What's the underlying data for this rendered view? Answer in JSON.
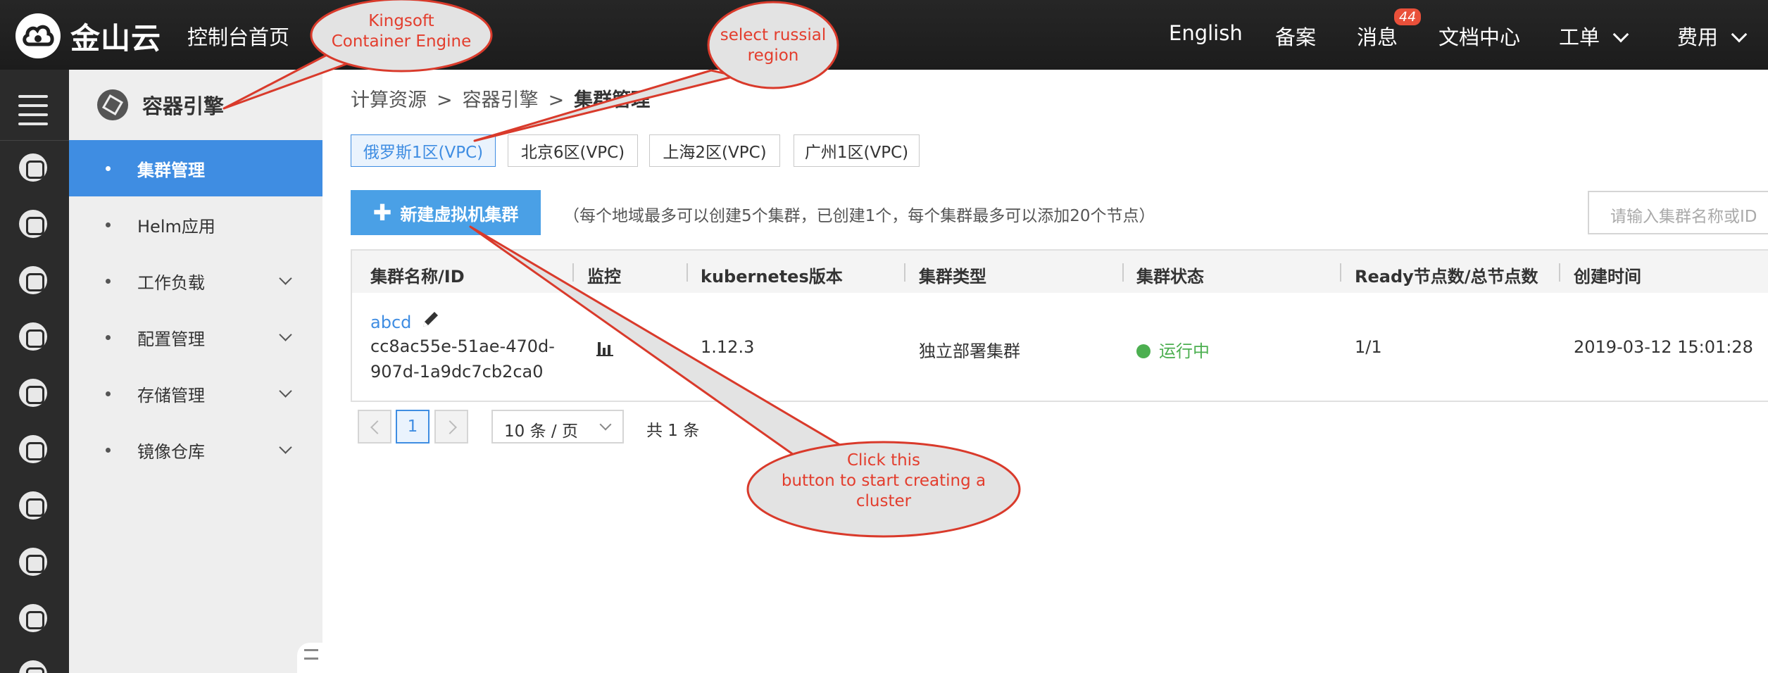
{
  "topbar": {
    "brand": "金山云",
    "home": "控制台首页",
    "nav": {
      "english": "English",
      "filing": "备案",
      "messages": "消息",
      "messages_badge": "44",
      "docs": "文档中心",
      "tickets": "工单",
      "billing": "费用"
    }
  },
  "sidebar": {
    "title": "容器引擎",
    "items": [
      {
        "label": "集群管理"
      },
      {
        "label": "Helm应用"
      },
      {
        "label": "工作负载"
      },
      {
        "label": "配置管理"
      },
      {
        "label": "存储管理"
      },
      {
        "label": "镜像仓库"
      }
    ]
  },
  "breadcrumb": {
    "level1": "计算资源",
    "level2": "容器引擎",
    "current": "集群管理",
    "separator": ">"
  },
  "regions": [
    "俄罗斯1区(VPC)",
    "北京6区(VPC)",
    "上海2区(VPC)",
    "广州1区(VPC)"
  ],
  "selected_region": "俄罗斯1区(VPC)",
  "toolbar": {
    "create_label": "新建虚拟机集群",
    "quota_note": "（每个地域最多可以创建5个集群，已创建1个，每个集群最多可以添加20个节点）",
    "search_placeholder": "请输入集群名称或ID"
  },
  "table": {
    "columns": [
      "集群名称/ID",
      "监控",
      "kubernetes版本",
      "集群类型",
      "集群状态",
      "Ready节点数/总节点数",
      "创建时间"
    ],
    "rows": [
      {
        "name": "abcd",
        "id_line1": "cc8ac55e-51ae-470d-",
        "id_line2": "907d-1a9dc7cb2ca0",
        "version": "1.12.3",
        "type": "独立部署集群",
        "status": "运行中",
        "nodes": "1/1",
        "created": "2019-03-12 15:01:28"
      }
    ]
  },
  "pagination": {
    "current_page": "1",
    "page_size": "10 条 / 页",
    "total": "共 1 条"
  },
  "annotations": {
    "engine_line1": "Kingsoft",
    "engine_line2": "Container Engine",
    "region_line1": "select russial",
    "region_line2": "region",
    "click_line1": "Click this",
    "click_line2": "button to start creating a",
    "click_line3": "cluster"
  },
  "colors": {
    "accent": "#3f8de2",
    "button": "#4aa0e6",
    "running": "#4caf50",
    "annotation_text": "#e33d2d",
    "callout_fill": "#e3e3e3"
  },
  "icons": {
    "edit": "pencil-icon",
    "monitor": "bar-chart-icon",
    "menu": "hamburger-menu-icon"
  }
}
